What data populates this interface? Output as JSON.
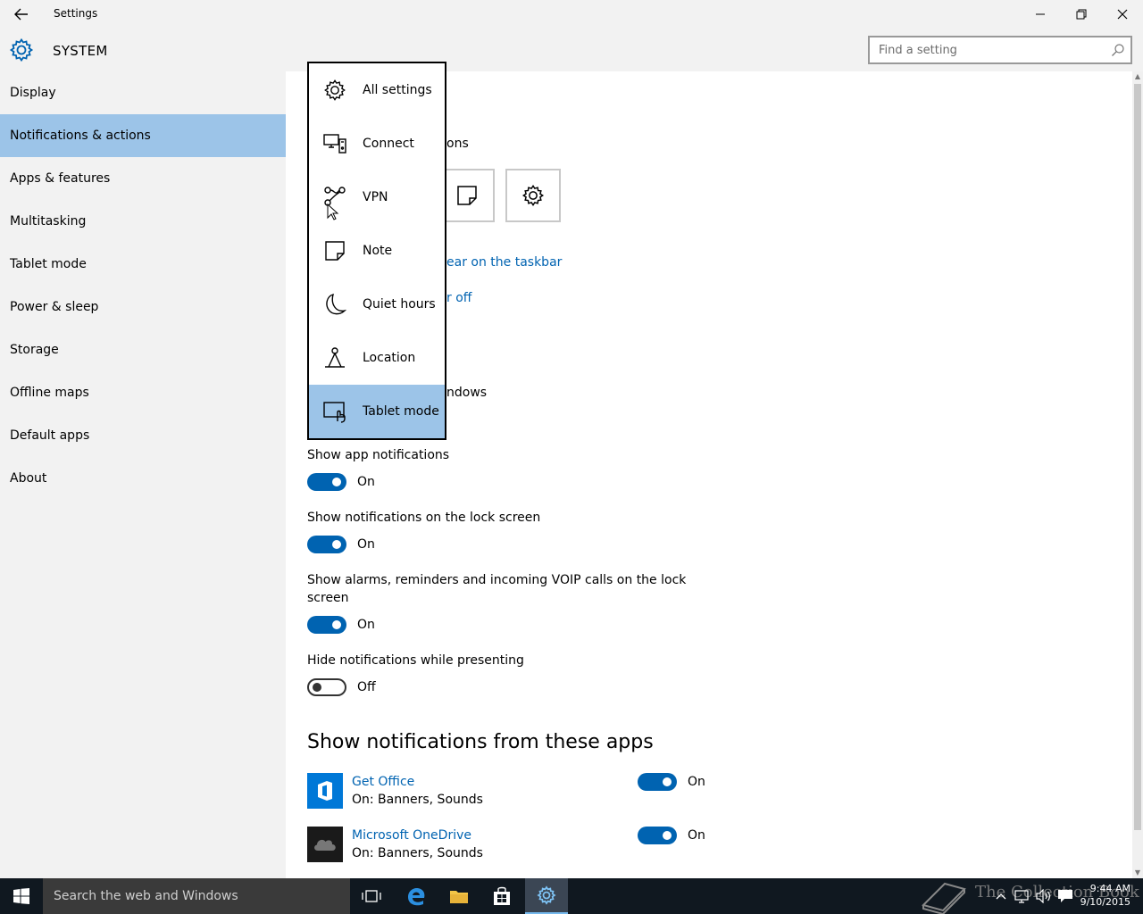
{
  "window": {
    "title": "Settings"
  },
  "header": {
    "section": "SYSTEM",
    "search_placeholder": "Find a setting"
  },
  "sidebar": {
    "items": [
      {
        "label": "Display"
      },
      {
        "label": "Notifications & actions",
        "active": true
      },
      {
        "label": "Apps & features"
      },
      {
        "label": "Multitasking"
      },
      {
        "label": "Tablet mode"
      },
      {
        "label": "Power & sleep"
      },
      {
        "label": "Storage"
      },
      {
        "label": "Offline maps"
      },
      {
        "label": "Default apps"
      },
      {
        "label": "About"
      }
    ]
  },
  "main": {
    "quick_actions_partial": "ons",
    "link_taskbar_partial": "ear on the taskbar",
    "link_off_partial": "r off",
    "windows_partial": "ndows",
    "settings": [
      {
        "label": "Show app notifications",
        "state": "On",
        "on": true
      },
      {
        "label": "Show notifications on the lock screen",
        "state": "On",
        "on": true
      },
      {
        "label_line1": "Show alarms, reminders and incoming VOIP calls on the lock",
        "label_line2": "screen",
        "state": "On",
        "on": true
      },
      {
        "label": "Hide notifications while presenting",
        "state": "Off",
        "on": false
      }
    ],
    "apps_heading": "Show notifications from these apps",
    "apps": [
      {
        "name": "Get Office",
        "detail": "On: Banners, Sounds",
        "state": "On",
        "color": "#0078d7"
      },
      {
        "name": "Microsoft OneDrive",
        "detail": "On: Banners, Sounds",
        "state": "On",
        "color": "#1a1a1a"
      }
    ]
  },
  "popup": {
    "items": [
      {
        "label": "All settings",
        "icon": "gear-icon"
      },
      {
        "label": "Connect",
        "icon": "connect-icon"
      },
      {
        "label": "VPN",
        "icon": "vpn-icon"
      },
      {
        "label": "Note",
        "icon": "note-icon"
      },
      {
        "label": "Quiet hours",
        "icon": "moon-icon"
      },
      {
        "label": "Location",
        "icon": "location-icon"
      },
      {
        "label": "Tablet mode",
        "icon": "tablet-mode-icon",
        "active": true
      }
    ]
  },
  "taskbar": {
    "search_text": "Search the web and Windows",
    "time": "9:44 AM",
    "date": "9/10/2015",
    "watermark": "The Collection Book"
  },
  "colors": {
    "accent": "#0063b1",
    "selection": "#9cc4e8",
    "sidebar_bg": "#f2f2f2"
  }
}
